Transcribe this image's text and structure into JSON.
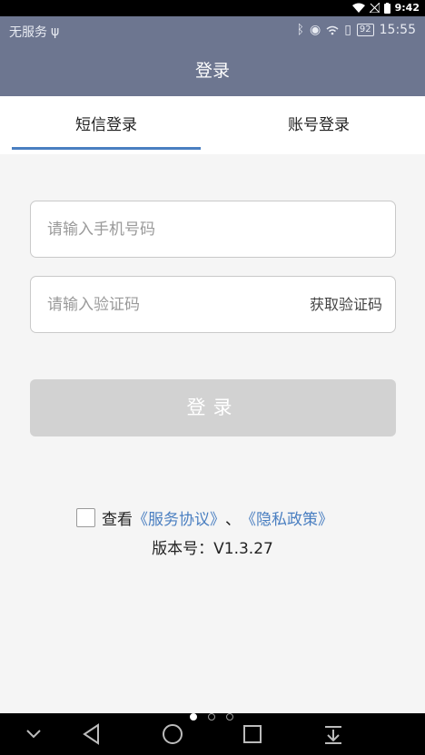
{
  "system_bar": {
    "time": "9:42"
  },
  "app_status": {
    "carrier": "无服务",
    "battery": "92",
    "time": "15:55"
  },
  "header": {
    "title": "登录"
  },
  "tabs": [
    {
      "label": "短信登录"
    },
    {
      "label": "账号登录"
    }
  ],
  "form": {
    "phone_placeholder": "请输入手机号码",
    "code_placeholder": "请输入验证码",
    "get_code_label": "获取验证码",
    "login_label": "登录"
  },
  "agreement": {
    "prefix": "查看",
    "service_link": "《服务协议》",
    "separator": "、",
    "privacy_link": "《隐私政策》"
  },
  "version": "版本号：V1.3.27",
  "colors": {
    "header_bg": "#6d7690",
    "accent": "#4a7fc1",
    "button_disabled": "#d2d2d2"
  }
}
